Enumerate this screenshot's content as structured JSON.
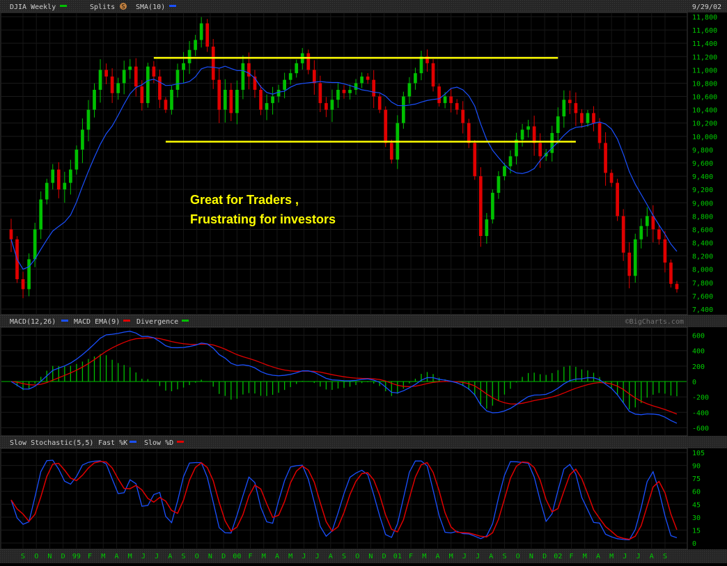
{
  "chart_data": [
    {
      "type": "candlestick",
      "header": {
        "title": "DJIA Weekly",
        "splits_label": "Splits",
        "splits_icon": "S",
        "sma_label": "SMA(10)",
        "date": "9/29/02"
      },
      "ylim": [
        7400,
        11800
      ],
      "y_ticks": [
        "7,400",
        "7,600",
        "7,800",
        "8,000",
        "8,200",
        "8,400",
        "8,600",
        "8,800",
        "9,000",
        "9,200",
        "9,400",
        "9,600",
        "9,800",
        "10,000",
        "10,200",
        "10,400",
        "10,600",
        "10,800",
        "11,000",
        "11,200",
        "11,400",
        "11,600",
        "11,800"
      ],
      "closes": [
        8450,
        7850,
        7700,
        8150,
        8600,
        9050,
        9300,
        9500,
        9200,
        9300,
        9500,
        9800,
        10100,
        10400,
        10700,
        11000,
        10900,
        10650,
        10800,
        11000,
        11050,
        10750,
        10500,
        11050,
        10900,
        10550,
        10400,
        10700,
        11000,
        11100,
        11300,
        11450,
        11700,
        11350,
        10850,
        10400,
        10700,
        10350,
        10700,
        11100,
        10900,
        10700,
        10400,
        10500,
        10600,
        10700,
        10850,
        10950,
        11100,
        11250,
        11000,
        10800,
        10500,
        10400,
        10550,
        10700,
        10650,
        10700,
        10800,
        10900,
        10850,
        10600,
        10400,
        9900,
        9650,
        10200,
        10600,
        10800,
        10950,
        11200,
        11100,
        10750,
        10500,
        10600,
        10500,
        10400,
        10200,
        9900,
        9400,
        8500,
        8750,
        9150,
        9400,
        9550,
        9700,
        9950,
        10100,
        10150,
        9900,
        9700,
        9750,
        10050,
        10300,
        10550,
        10500,
        10350,
        10200,
        10350,
        10200,
        9900,
        9450,
        9300,
        8800,
        8250,
        7900,
        8450,
        8650,
        8800,
        8600,
        8450,
        8100,
        7780,
        7700
      ],
      "trend_lines": [
        {
          "value": 11180,
          "from": 24,
          "to": 92
        },
        {
          "value": 9920,
          "from": 26,
          "to": 95
        }
      ],
      "annotation": [
        "Great for Traders ,",
        "Frustrating for investors"
      ],
      "watermark": "©BigCharts.com",
      "colors": {
        "up": "#00c000",
        "down": "#e00000",
        "sma": "#1a50ff",
        "trend": "#ffff00",
        "annotation": "#ffff00",
        "axis_text": "#00cc00",
        "header_text": "#d0d0d0"
      }
    },
    {
      "type": "line",
      "header": {
        "macd_label": "MACD(12,26)",
        "ema_label": "MACD EMA(9)",
        "div_label": "Divergence"
      },
      "ylim": [
        -650,
        650
      ],
      "y_ticks": [
        "600",
        "400",
        "200",
        "0",
        "-200",
        "-400",
        "-600"
      ],
      "colors": {
        "macd": "#1a50ff",
        "ema": "#e00000",
        "divergence": "#00c000"
      }
    },
    {
      "type": "line",
      "header": {
        "title": "Slow Stochastic(5,5)",
        "fast_label": "Fast %K",
        "slow_label": "Slow %D"
      },
      "ylim": [
        0,
        105
      ],
      "y_ticks": [
        "105",
        "90",
        "75",
        "60",
        "45",
        "30",
        "15",
        "0"
      ],
      "colors": {
        "k": "#1a50ff",
        "d": "#e00000"
      }
    }
  ],
  "x_axis": {
    "labels": [
      "S",
      "O",
      "N",
      "D",
      "99",
      "F",
      "M",
      "A",
      "M",
      "J",
      "J",
      "A",
      "S",
      "O",
      "N",
      "D",
      "00",
      "F",
      "M",
      "A",
      "M",
      "J",
      "J",
      "A",
      "S",
      "O",
      "N",
      "D",
      "01",
      "F",
      "M",
      "A",
      "M",
      "J",
      "J",
      "A",
      "S",
      "O",
      "N",
      "D",
      "02",
      "F",
      "M",
      "A",
      "M",
      "J",
      "J",
      "A",
      "S"
    ]
  }
}
